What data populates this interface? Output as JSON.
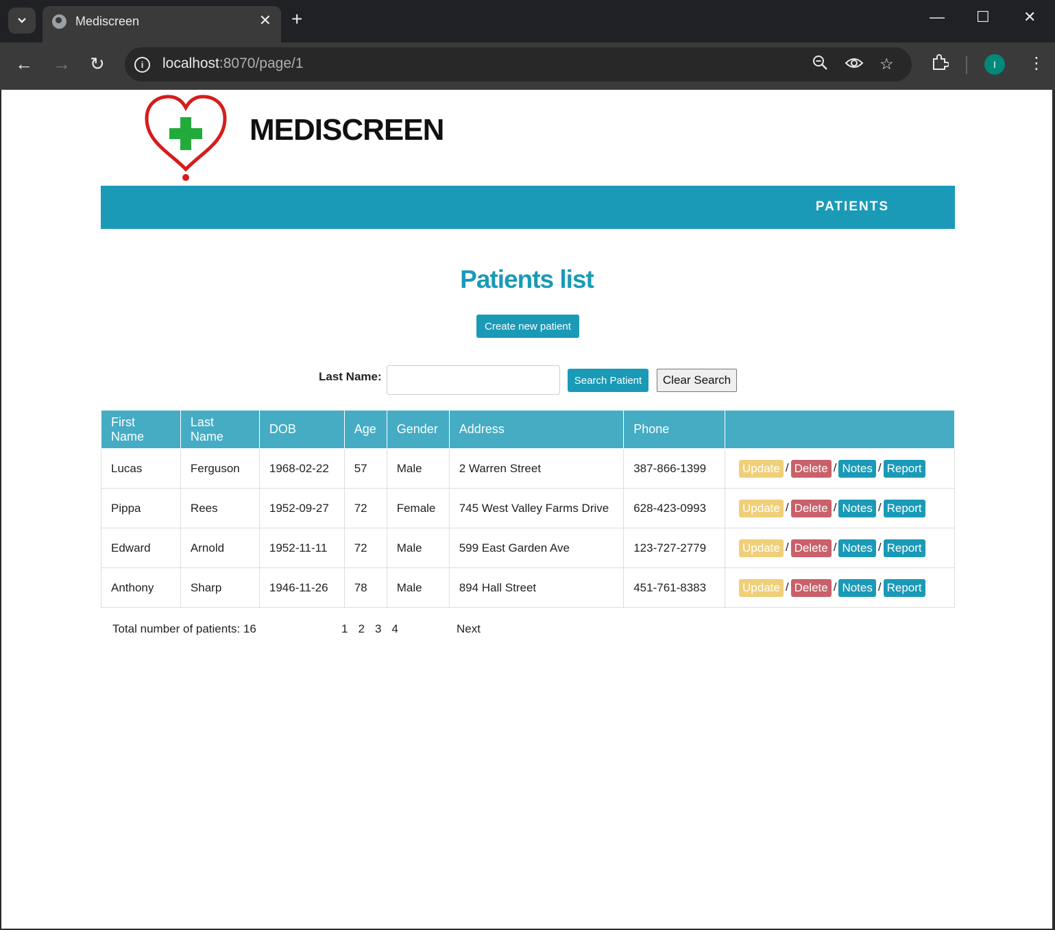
{
  "browser": {
    "tab_title": "Mediscreen",
    "url_host": "localhost",
    "url_rest": ":8070/page/1",
    "profile_initial": "I"
  },
  "header": {
    "brand": "MEDISCREEN",
    "nav_patients": "PATIENTS",
    "colors": {
      "primary": "#1a9ab7",
      "header_row": "#45acc4",
      "update": "#f0cf79",
      "delete": "#c9606a"
    }
  },
  "main": {
    "title": "Patients list",
    "create_button": "Create new patient",
    "search": {
      "label": "Last Name:",
      "value": "",
      "search_button": "Search Patient",
      "clear_button": "Clear Search"
    },
    "table": {
      "headers": [
        "First Name",
        "Last Name",
        "DOB",
        "Age",
        "Gender",
        "Address",
        "Phone",
        ""
      ],
      "rows": [
        {
          "first": "Lucas",
          "last": "Ferguson",
          "dob": "1968-02-22",
          "age": "57",
          "gender": "Male",
          "address": "2 Warren Street",
          "phone": "387-866-1399"
        },
        {
          "first": "Pippa",
          "last": "Rees",
          "dob": "1952-09-27",
          "age": "72",
          "gender": "Female",
          "address": "745 West Valley Farms Drive",
          "phone": "628-423-0993"
        },
        {
          "first": "Edward",
          "last": "Arnold",
          "dob": "1952-11-11",
          "age": "72",
          "gender": "Male",
          "address": "599 East Garden Ave",
          "phone": "123-727-2779"
        },
        {
          "first": "Anthony",
          "last": "Sharp",
          "dob": "1946-11-26",
          "age": "78",
          "gender": "Male",
          "address": "894 Hall Street",
          "phone": "451-761-8383"
        }
      ],
      "actions": {
        "update": "Update",
        "delete": "Delete",
        "notes": "Notes",
        "report": "Report",
        "separator": "/"
      }
    },
    "footer": {
      "total": "Total number of patients: 16",
      "pages": [
        "1",
        "2",
        "3",
        "4"
      ],
      "next": "Next"
    }
  }
}
